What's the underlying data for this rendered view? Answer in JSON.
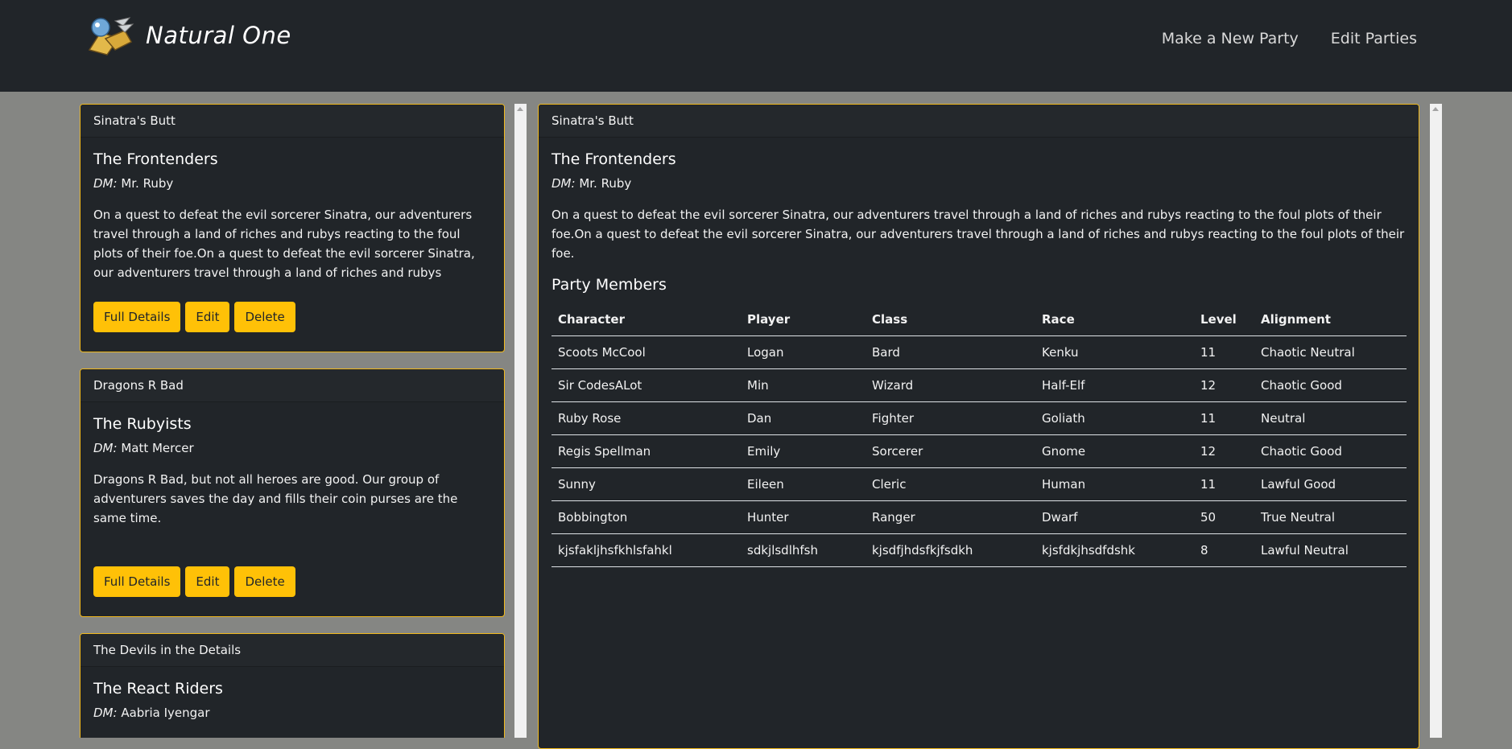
{
  "brand": {
    "name": "Natural One"
  },
  "nav": {
    "new_party": "Make a New Party",
    "edit_parties": "Edit Parties"
  },
  "parties": [
    {
      "campaign": "Sinatra's Butt",
      "name": "The Frontenders",
      "dm_label": "DM:",
      "dm": "Mr. Ruby",
      "description": "On a quest to defeat the evil sorcerer Sinatra, our adventurers travel through a land of riches and rubys reacting to the foul plots of their foe.On a quest to defeat the evil sorcerer Sinatra, our adventurers travel through a land of riches and rubys reacting to the foul plots"
    },
    {
      "campaign": "Dragons R Bad",
      "name": "The Rubyists",
      "dm_label": "DM:",
      "dm": "Matt Mercer",
      "description": "Dragons R Bad, but not all heroes are good. Our group of adventurers saves the day and fills their coin purses are the same time."
    },
    {
      "campaign": "The Devils in the Details",
      "name": "The React Riders",
      "dm_label": "DM:",
      "dm": "Aabria Iyengar"
    }
  ],
  "buttons": {
    "details": "Full Details",
    "edit": "Edit",
    "delete": "Delete"
  },
  "detail": {
    "campaign": "Sinatra's Butt",
    "name": "The Frontenders",
    "dm_label": "DM:",
    "dm": "Mr. Ruby",
    "description": "On a quest to defeat the evil sorcerer Sinatra, our adventurers travel through a land of riches and rubys reacting to the foul plots of their foe.On a quest to defeat the evil sorcerer Sinatra, our adventurers travel through a land of riches and rubys reacting to the foul plots of their foe.",
    "members_title": "Party Members",
    "columns": [
      "Character",
      "Player",
      "Class",
      "Race",
      "Level",
      "Alignment"
    ],
    "members": [
      [
        "Scoots McCool",
        "Logan",
        "Bard",
        "Kenku",
        "11",
        "Chaotic Neutral"
      ],
      [
        "Sir CodesALot",
        "Min",
        "Wizard",
        "Half-Elf",
        "12",
        "Chaotic Good"
      ],
      [
        "Ruby Rose",
        "Dan",
        "Fighter",
        "Goliath",
        "11",
        "Neutral"
      ],
      [
        "Regis Spellman",
        "Emily",
        "Sorcerer",
        "Gnome",
        "12",
        "Chaotic Good"
      ],
      [
        "Sunny",
        "Eileen",
        "Cleric",
        "Human",
        "11",
        "Lawful Good"
      ],
      [
        "Bobbington",
        "Hunter",
        "Ranger",
        "Dwarf",
        "50",
        "True Neutral"
      ],
      [
        "kjsfakljhsfkhlsfahkl",
        "sdkjlsdlhfsh",
        "kjsdfjhdsfkjfsdkh",
        "kjsfdkjhsdfdshk",
        "8",
        "Lawful Neutral"
      ]
    ]
  }
}
